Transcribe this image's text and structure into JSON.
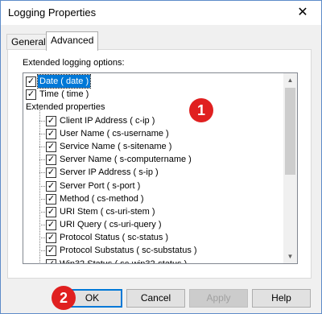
{
  "window": {
    "title": "Logging Properties",
    "close_symbol": "✕"
  },
  "tabs": [
    {
      "label": "General"
    },
    {
      "label": "Advanced"
    }
  ],
  "group_label": "Extended logging options:",
  "tree_items": [
    {
      "label": "Date  ( date )",
      "checked": true,
      "selected": true
    },
    {
      "label": "Time  ( time )",
      "checked": true
    },
    {
      "label": "Extended properties"
    },
    {
      "label": "Client IP Address  ( c-ip )",
      "checked": true
    },
    {
      "label": "User Name  ( cs-username )",
      "checked": true
    },
    {
      "label": "Service Name  ( s-sitename )",
      "checked": true
    },
    {
      "label": "Server Name  ( s-computername )",
      "checked": true
    },
    {
      "label": "Server IP Address  ( s-ip )",
      "checked": true
    },
    {
      "label": "Server Port  ( s-port )",
      "checked": true
    },
    {
      "label": "Method  ( cs-method )",
      "checked": true
    },
    {
      "label": "URI Stem  ( cs-uri-stem )",
      "checked": true
    },
    {
      "label": "URI Query  ( cs-uri-query )",
      "checked": true
    },
    {
      "label": "Protocol Status  ( sc-status )",
      "checked": true
    },
    {
      "label": "Protocol Substatus  ( sc-substatus )",
      "checked": true
    },
    {
      "label": "Win32 Status  ( sc-win32-status )",
      "checked": true
    }
  ],
  "badges": {
    "one": "1",
    "two": "2"
  },
  "buttons": {
    "ok": "OK",
    "cancel": "Cancel",
    "apply": "Apply",
    "help": "Help"
  },
  "scroll": {
    "up_glyph": "▲",
    "down_glyph": "▼"
  },
  "colors": {
    "selection": "#0078d7",
    "badge": "#e02020",
    "default_button_border": "#0078d7"
  }
}
